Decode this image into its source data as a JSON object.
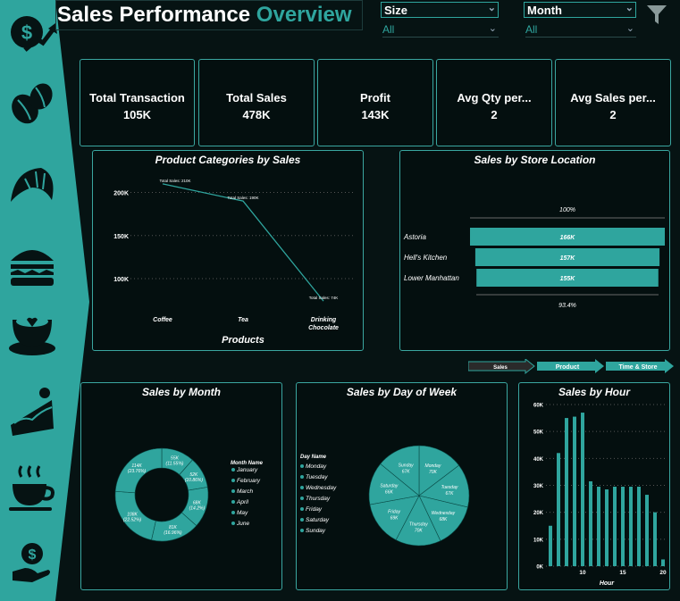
{
  "header": {
    "title_main": "Sales Performance",
    "title_accent": "Overview"
  },
  "slicers": [
    {
      "label": "Size",
      "value": "All"
    },
    {
      "label": "Month",
      "value": "All"
    }
  ],
  "kpis": [
    {
      "label": "Total Transaction",
      "value": "105K"
    },
    {
      "label": "Total Sales",
      "value": "478K"
    },
    {
      "label": "Profit",
      "value": "143K"
    },
    {
      "label": "Avg Qty per...",
      "value": "2"
    },
    {
      "label": "Avg Sales per...",
      "value": "2"
    }
  ],
  "nav": {
    "sales": "Sales",
    "product": "Product",
    "time_store": "Time & Store"
  },
  "colors": {
    "accent": "#2fa59e",
    "background": "#061313",
    "panel_border": "#3aa6a0"
  },
  "sidebar_icons": [
    "sales-icon",
    "coffee-beans-icon",
    "croissant-icon",
    "sandwich-icon",
    "latte-icon",
    "cake-icon",
    "hot-cup-icon",
    "money-hand-icon"
  ],
  "chart_data": [
    {
      "type": "line",
      "title": "Product Categories by Sales",
      "xlabel": "Products",
      "ylabel": "",
      "categories": [
        "Coffee",
        "Tea",
        "Drinking Chocolate"
      ],
      "values": [
        210,
        190,
        74
      ],
      "data_labels": [
        "Total Sales: 210K",
        "Total Sales: 190K",
        "Total Sales: 74K"
      ],
      "yticks": [
        "100K",
        "150K",
        "200K"
      ],
      "ylim": [
        70,
        215
      ],
      "grid": true
    },
    {
      "type": "bar",
      "orientation": "horizontal",
      "title": "Sales by Store Location",
      "categories": [
        "Astoria",
        "Hell's Kitchen",
        "Lower Manhattan"
      ],
      "values": [
        166,
        157,
        155
      ],
      "value_labels": [
        "166K",
        "157K",
        "155K"
      ],
      "top_label": "100%",
      "bottom_label": "93.4%"
    },
    {
      "type": "pie",
      "variant": "donut",
      "title": "Sales by Month",
      "legend_title": "Month Name",
      "legend_position": "right",
      "categories": [
        "January",
        "February",
        "March",
        "April",
        "May",
        "June"
      ],
      "values": [
        55,
        52,
        68,
        81,
        108,
        114
      ],
      "slice_labels": [
        "55K (11.55%)",
        "52K (10.86%)",
        "68K (14.2%)",
        "81K (16.96%)",
        "108K (22.52%)",
        "114K (23.76%)"
      ]
    },
    {
      "type": "pie",
      "title": "Sales by Day of Week",
      "legend_title": "Day Name",
      "legend_position": "left",
      "categories": [
        "Monday",
        "Tuesday",
        "Wednesday",
        "Thursday",
        "Friday",
        "Saturday",
        "Sunday"
      ],
      "values": [
        70,
        67,
        68,
        70,
        69,
        66,
        67
      ],
      "slice_labels": [
        "Monday 70K",
        "Tuesday 67K",
        "Wednesday 68K",
        "Thursday 70K",
        "Friday 69K",
        "Saturday 66K",
        "Sunday 67K"
      ]
    },
    {
      "type": "bar",
      "title": "Sales by Hour",
      "xlabel": "Hour",
      "ylabel": "",
      "categories": [
        6,
        7,
        8,
        9,
        10,
        11,
        12,
        13,
        14,
        15,
        16,
        17,
        18,
        19,
        20
      ],
      "values": [
        15000,
        42000,
        55000,
        55500,
        57000,
        31500,
        29500,
        28500,
        29500,
        29500,
        29500,
        29500,
        26500,
        20000,
        2500
      ],
      "yticks": [
        "0K",
        "10K",
        "20K",
        "30K",
        "40K",
        "50K",
        "60K"
      ],
      "xticks": [
        "10",
        "15",
        "20"
      ],
      "ylim": [
        0,
        60000
      ],
      "grid": true
    }
  ]
}
